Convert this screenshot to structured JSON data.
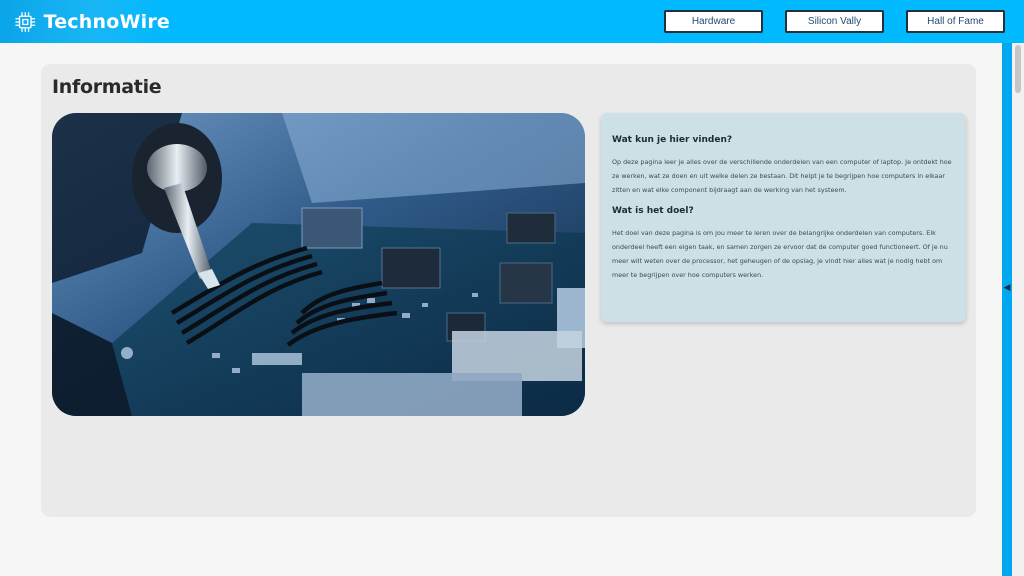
{
  "header": {
    "brand": "TechnoWire",
    "brand_icon": "chip-icon",
    "nav": [
      "Hardware",
      "Silicon Vally",
      "Hall of Fame"
    ]
  },
  "main": {
    "title": "Informatie",
    "image_icon": "motherboard-photo",
    "sections": [
      {
        "heading": "Wat kun je hier vinden?",
        "text": "Op deze pagina leer je alles over de verschillende onderdelen van een computer of laptop. Je ontdekt hoe ze werken, wat ze doen en uit welke delen ze bestaan. Dit helpt je te begrijpen hoe computers in elkaar zitten en wat elke component bijdraagt aan de werking van het systeem."
      },
      {
        "heading": "Wat is het doel?",
        "text": "Het doel van deze pagina is om jou meer te leren over de belangrijke onderdelen van computers. Elk onderdeel heeft een eigen taak, en samen zorgen ze ervoor dat de computer goed functioneert. Of je nu meer wilt weten over de processor, het geheugen of de opslag, je vindt hier alles wat je nodig hebt om meer te begrijpen over hoe computers werken."
      }
    ]
  },
  "sidebar": {
    "toggle_icon": "collapse-arrow-icon",
    "toggle_glyph": "◀"
  },
  "colors": {
    "header_bg": "#00b9ff",
    "accent": "#00a9ef",
    "card_bg": "#eaeaea",
    "info_bg": "#cce0e5"
  }
}
